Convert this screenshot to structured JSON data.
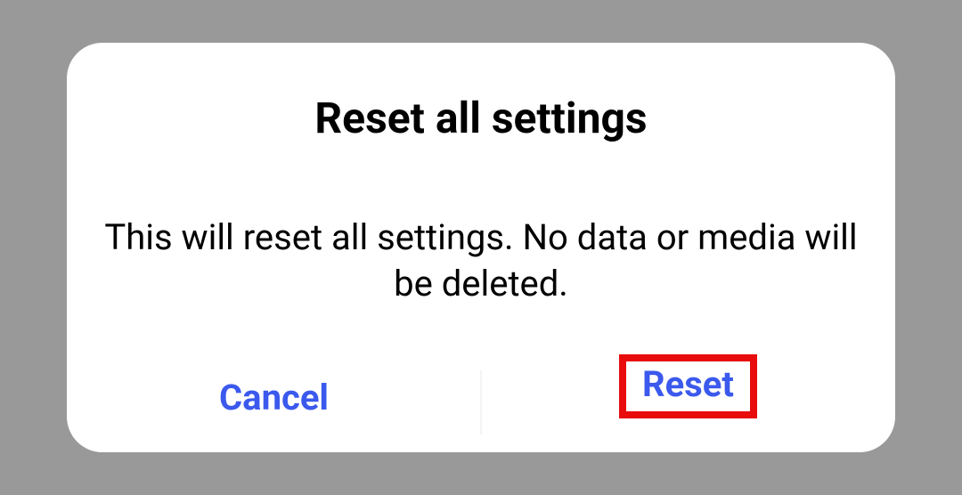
{
  "dialog": {
    "title": "Reset all settings",
    "body": "This will reset all settings. No data or media will be deleted.",
    "actions": {
      "cancel": "Cancel",
      "confirm": "Reset"
    }
  }
}
